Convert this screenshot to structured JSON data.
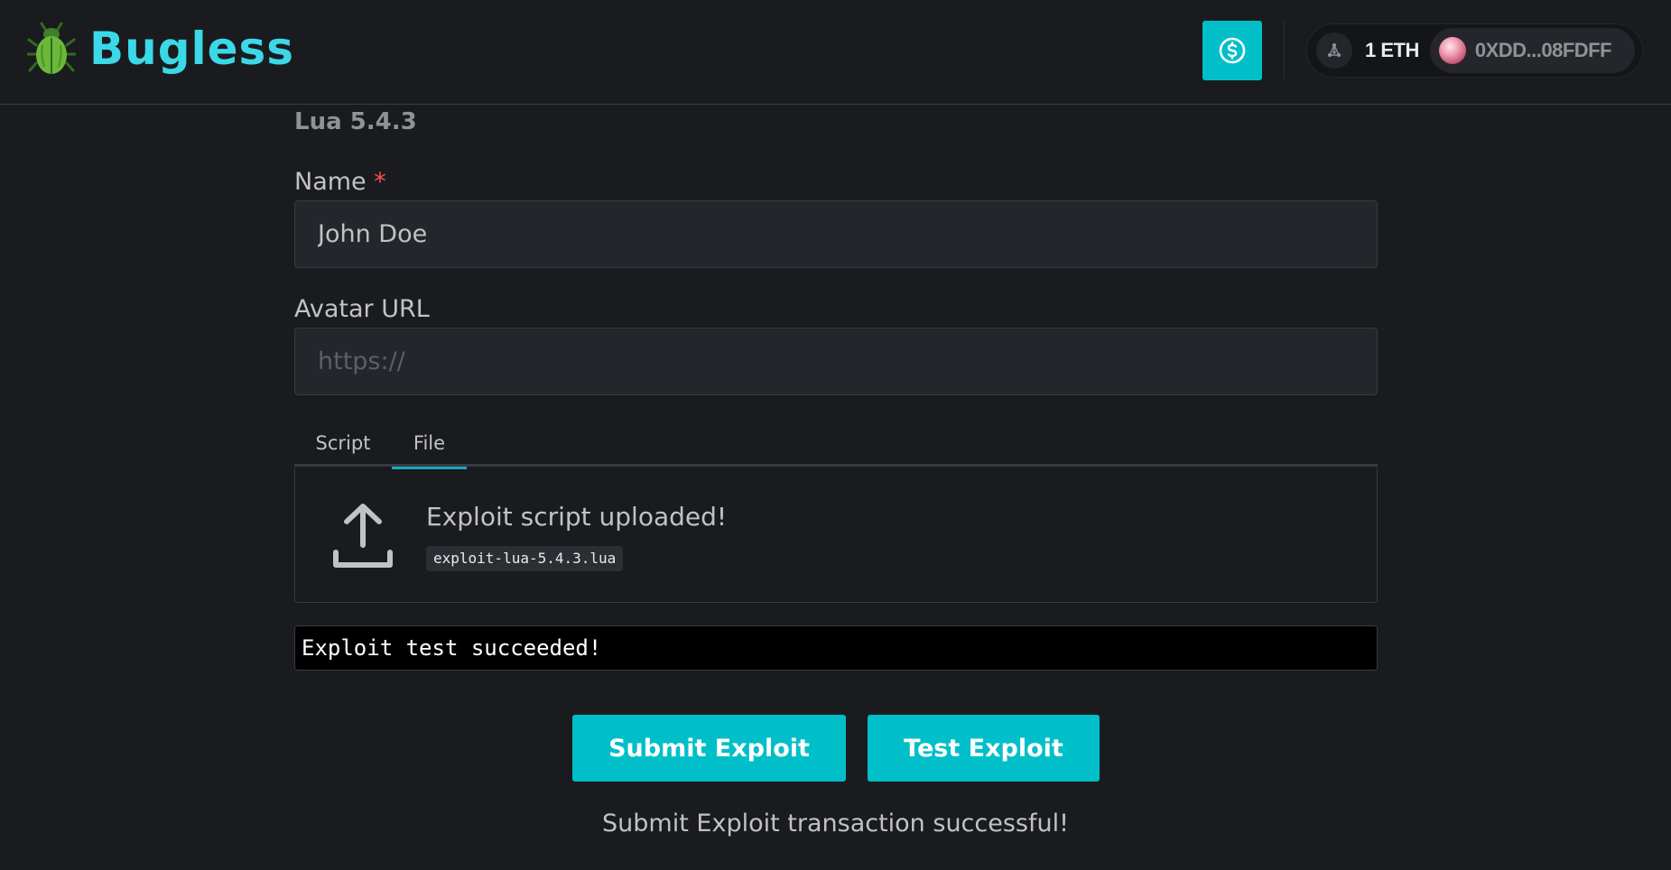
{
  "header": {
    "brand_name": "Bugless",
    "brand_icon": "beetle-icon",
    "action_icon": "dollar-circle-icon",
    "balance": "1 ETH",
    "address": "0XDD...08FDFF",
    "network_icon": "ethereum-network-icon"
  },
  "form": {
    "version_label": "Lua 5.4.3",
    "name_label": "Name",
    "required_mark": "*",
    "name_value": "John Doe",
    "avatar_label": "Avatar URL",
    "avatar_placeholder": "https://",
    "tabs": [
      {
        "label": "Script",
        "active": false
      },
      {
        "label": "File",
        "active": true
      }
    ],
    "upload_title": "Exploit script uploaded!",
    "file_name": "exploit-lua-5.4.3.lua",
    "console_output": "Exploit test succeeded!",
    "submit_label": "Submit Exploit",
    "test_label": "Test Exploit",
    "status_message": "Submit Exploit transaction successful!"
  },
  "colors": {
    "accent": "#00bfc9",
    "brand": "#3bd8e8",
    "background": "#1a1b1e",
    "input_bg": "#25262b"
  }
}
